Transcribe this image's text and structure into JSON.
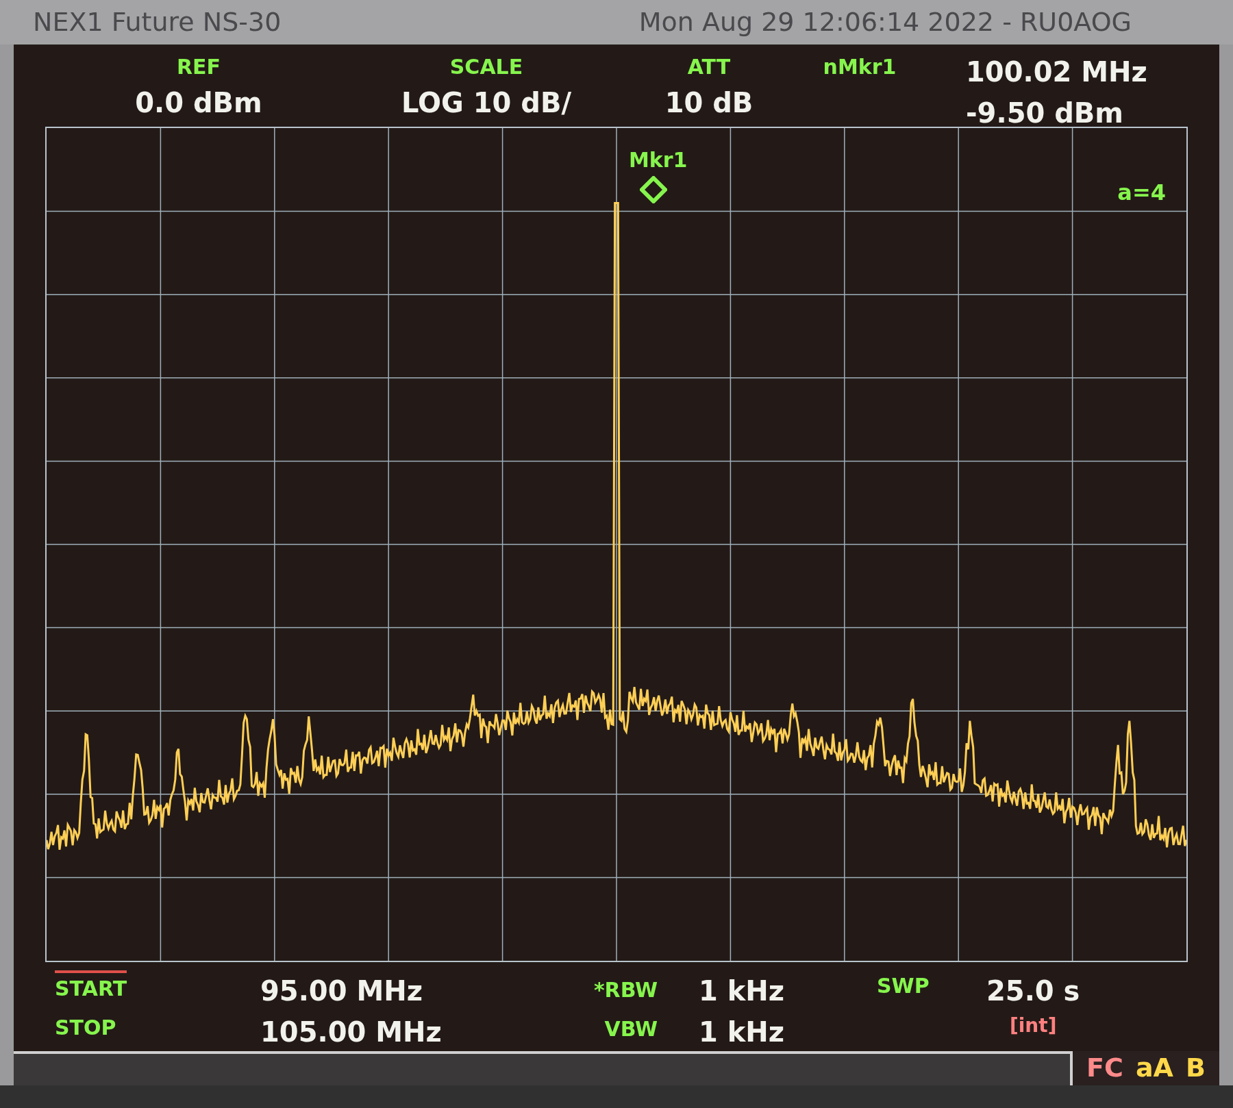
{
  "title_bar": {
    "instrument": "NEX1 Future NS-30",
    "datetime": "Mon Aug 29 12:06:14 2022 - RU0AOG"
  },
  "header": [
    {
      "label": "REF",
      "value": "0.0 dBm"
    },
    {
      "label": "SCALE",
      "value": "LOG 10 dB/"
    },
    {
      "label": "ATT",
      "value": "10 dB"
    }
  ],
  "marker_readout": {
    "label": "nMkr1",
    "frequency": "100.02 MHz",
    "amplitude": "-9.50 dBm"
  },
  "plot": {
    "marker_label": "Mkr1",
    "averaging": "a=4"
  },
  "footer": {
    "start_label": "START",
    "start_value": "95.00 MHz",
    "stop_label": "STOP",
    "stop_value": "105.00 MHz",
    "rbw_label": "*RBW",
    "rbw_value": "1 kHz",
    "vbw_label": "VBW",
    "vbw_value": "1 kHz",
    "swp_label": "SWP",
    "swp_value": "25.0 s",
    "swp_mode": "[int]"
  },
  "status_flags": [
    {
      "text": "FC",
      "color": "#ff8a8a"
    },
    {
      "text": "aA",
      "color": "#ffd84a"
    },
    {
      "text": "B",
      "color": "#ffd84a"
    }
  ]
}
